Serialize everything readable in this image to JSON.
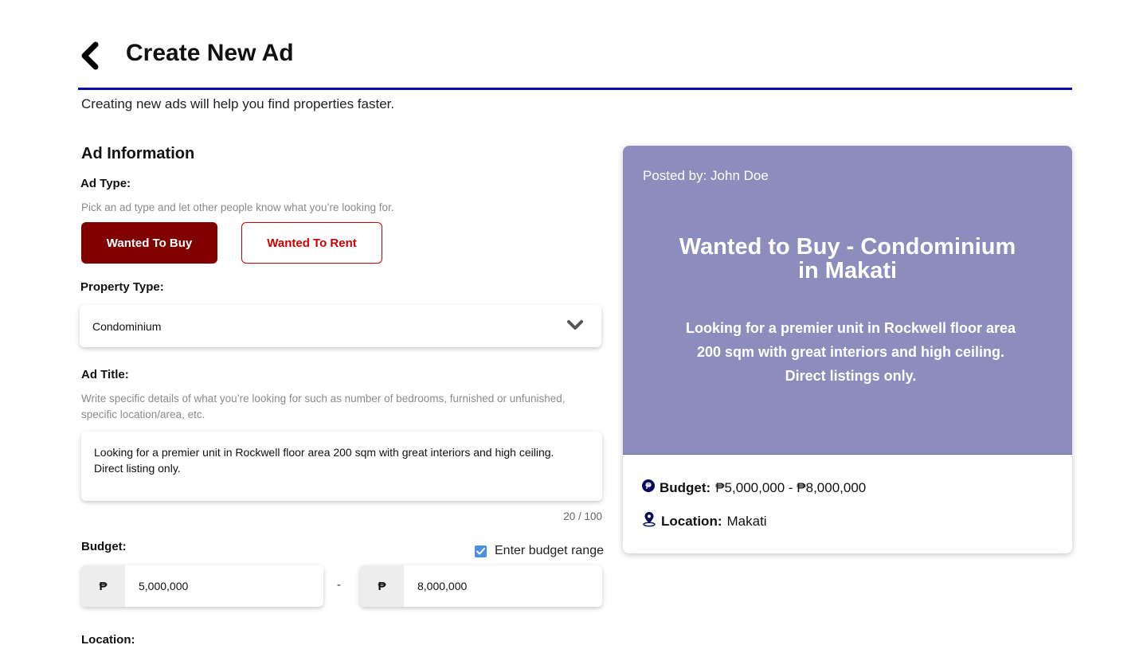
{
  "header": {
    "title": "Create New Ad",
    "subtitle": "Creating new ads will help you find properties faster."
  },
  "form": {
    "section_title": "Ad Information",
    "ad_type": {
      "label": "Ad Type:",
      "hint": "Pick an ad type and let other people know what you’re looking for.",
      "options": [
        "Wanted To Buy",
        "Wanted To Rent"
      ],
      "selected": "Wanted To Buy"
    },
    "property_type": {
      "label": "Property Type:",
      "value": "Condominium"
    },
    "ad_title": {
      "label": "Ad Title:",
      "hint_line1": "Write specific details of what you’re looking for such as number of bedrooms, furnished or unfunished,",
      "hint_line2": "specific location/area, etc.",
      "value_line1": "Looking for a premier unit in Rockwell floor area 200 sqm with great interiors and high ceiling.",
      "value_line2": "Direct listing only.",
      "counter": "20 / 100"
    },
    "budget": {
      "label": "Budget:",
      "range_checkbox_label": "Enter budget range",
      "range_checked": true,
      "currency": "₱",
      "min": "5,000,000",
      "max": "8,000,000",
      "separator": "-"
    },
    "location_label": "Location:"
  },
  "preview": {
    "posted_by": "Posted by: John Doe",
    "title_line1": "Wanted to Buy - Condominium",
    "title_line2": "in Makati",
    "desc_line1": "Looking for a premier unit in Rockwell floor area",
    "desc_line2": "200 sqm with great interiors and high ceiling.",
    "desc_line3": "Direct listings only.",
    "budget_label": "Budget:",
    "budget_value": "₱5,000,000 - ₱8,000,000",
    "location_label": "Location:",
    "location_value": "Makati",
    "card_color": "#8c8dbc"
  },
  "colors": {
    "accent_rule": "#0a0aa8",
    "primary_button": "#800000",
    "outline_button": "#cc0000",
    "checkbox": "#4a90e2"
  }
}
